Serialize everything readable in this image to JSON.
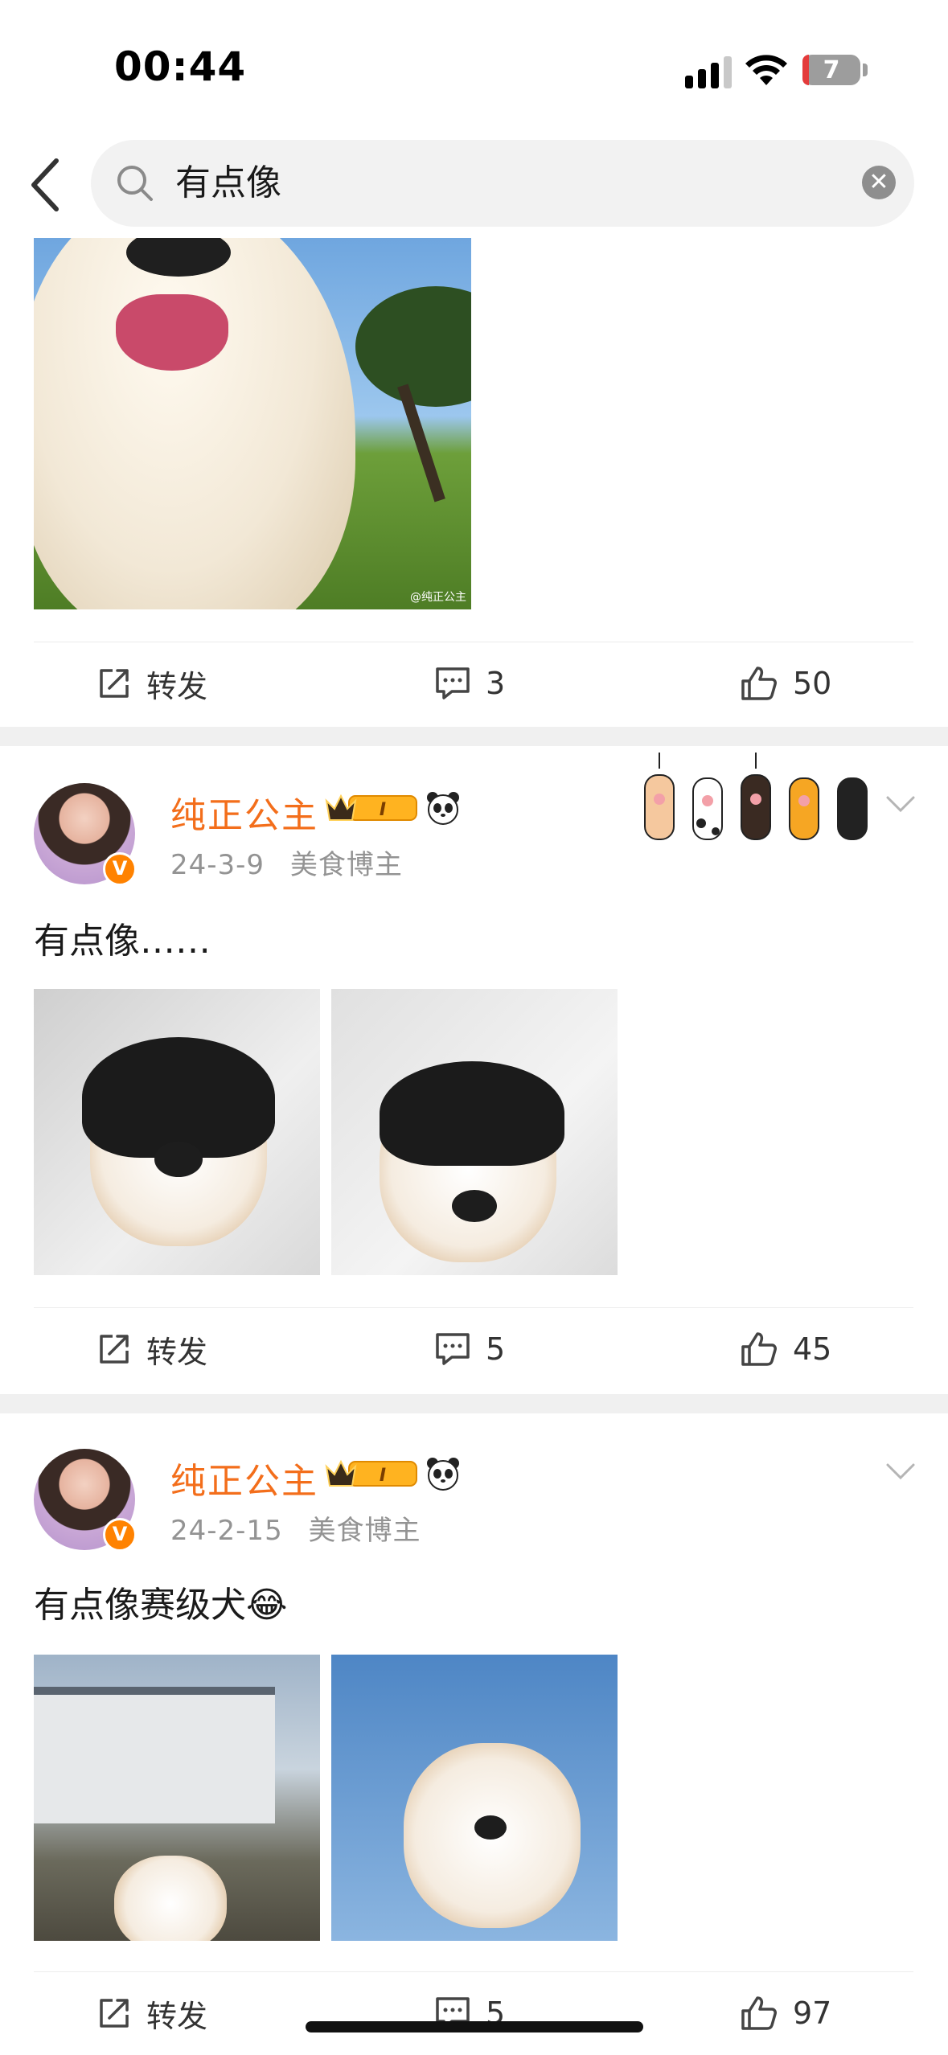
{
  "status_bar": {
    "time": "00:44",
    "battery": "7",
    "icons": [
      "cellular-signal-icon",
      "wifi-icon",
      "battery-icon"
    ]
  },
  "search": {
    "query": "有点像",
    "icons": [
      "back-arrow-icon",
      "search-icon",
      "clear-icon"
    ]
  },
  "top_post": {
    "image_alt": "白色长毛狗狗吐舌头的照片",
    "watermark": "@纯正公主",
    "actions": {
      "repost_label": "转发",
      "comment_count": "3",
      "like_count": "50"
    }
  },
  "posts": [
    {
      "username": "纯正公主",
      "date": "24-3-9",
      "tag": "美食博主",
      "text": "有点像……",
      "verified_mark": "V",
      "badge_level": "I",
      "actions": {
        "repost_label": "转发",
        "comment_count": "5",
        "like_count": "45"
      }
    },
    {
      "username": "纯正公主",
      "date": "24-2-15",
      "tag": "美食博主",
      "text": "有点像赛级犬😂",
      "verified_mark": "V",
      "badge_level": "I",
      "actions": {
        "repost_label": "转发",
        "comment_count": "5",
        "like_count": "97"
      }
    }
  ],
  "colors": {
    "username": "#f36e1b",
    "verified": "#ff8200",
    "meta": "#939393",
    "separator": "#f0f0f0"
  }
}
